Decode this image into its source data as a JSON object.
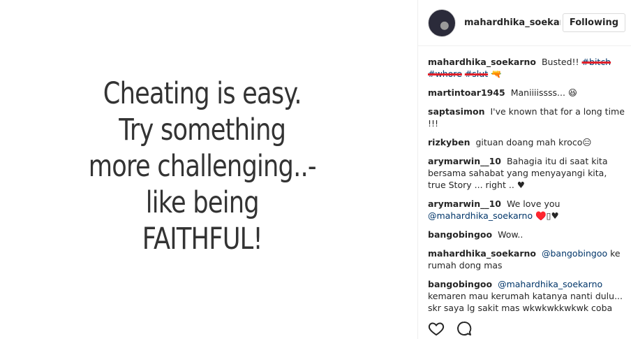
{
  "image": {
    "quote_lines": [
      "Cheating is easy.",
      "Try something",
      "more challenging..-",
      "like being",
      "FAITHFUL!"
    ]
  },
  "header": {
    "username": "mahardhika_soekarno",
    "follow_label": "Following"
  },
  "caption": {
    "username": "mahardhika_soekarno",
    "text": "Busted!!",
    "tags": [
      "#bitch",
      "#whore",
      "#slut"
    ],
    "emoji": "🔫"
  },
  "comments": [
    {
      "username": "martintoar1945",
      "text": "Maniiiissss... 😆"
    },
    {
      "username": "saptasimon",
      "text": "I've known that for a long time !!!"
    },
    {
      "username": "rizkyben",
      "text": "gituan doang mah kroco😑"
    },
    {
      "username": "arymarwin__10",
      "text": "Bahagia itu di saat kita bersama sahabat yang menyayangi kita, true Story ... right .. ♥"
    },
    {
      "username": "arymarwin__10",
      "mention": "@mahardhika_soekarno",
      "text_before": "We love you",
      "text_after": "♥️▯♥"
    },
    {
      "username": "bangobingoo",
      "text": "Wow.."
    },
    {
      "username": "mahardhika_soekarno",
      "mention": "@bangobingoo",
      "text_after": "ke rumah dong mas"
    },
    {
      "username": "bangobingoo",
      "mention": "@mahardhika_soekarno",
      "text_after": "kemaren mau kerumah katanya nanti dulu... skr saya lg sakit mas wkwkwkkwkwk coba liat besok kalo enakan saya main kesana"
    }
  ],
  "actions": {
    "like_icon": "heart-icon",
    "comment_icon": "comment-icon"
  }
}
